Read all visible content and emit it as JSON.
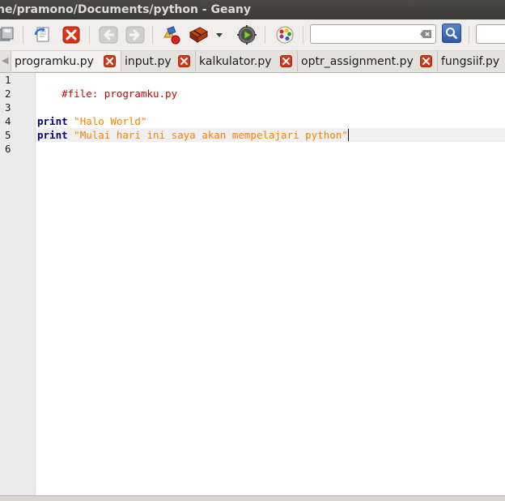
{
  "window": {
    "title": "ne/pramono/Documents/python - Geany"
  },
  "toolbar": {
    "icons": [
      "save-all-icon",
      "revert-icon",
      "close-icon",
      "back-icon",
      "forward-icon",
      "compile-icon",
      "build-icon",
      "build-dropdown-icon",
      "execute-icon",
      "color-chooser-icon",
      "search-clear-icon",
      "search-icon"
    ],
    "search_value": "",
    "goto_value": ""
  },
  "tabs": [
    {
      "label": "programku.py",
      "active": true
    },
    {
      "label": "input.py",
      "active": false
    },
    {
      "label": "kalkulator.py",
      "active": false
    },
    {
      "label": "optr_assignment.py",
      "active": false
    },
    {
      "label": "fungsiif.py",
      "active": false
    }
  ],
  "editor": {
    "line_numbers": [
      "1",
      "2",
      "3",
      "4",
      "5",
      "6"
    ],
    "current_line": 5,
    "lines": [
      {
        "comment": "#file: programku.py"
      },
      {},
      {},
      {
        "keyword": "print",
        "string": "\"Halo World\""
      },
      {
        "keyword": "print",
        "string": "\"Mulai hari ini saya akan mempelajari python\""
      },
      {}
    ]
  },
  "colors": {
    "keyword": "#00007f",
    "string": "#ff8000",
    "comment": "#d00000",
    "tab_close": "#d2391b"
  }
}
